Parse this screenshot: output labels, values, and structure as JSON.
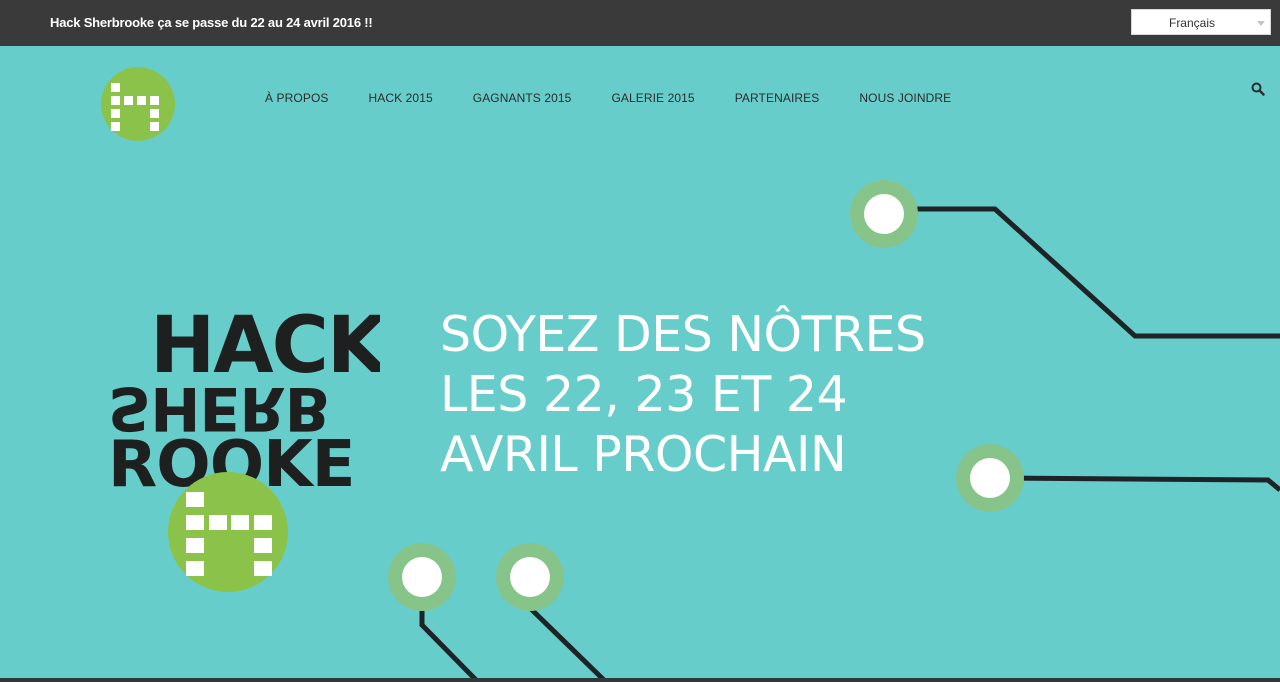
{
  "topbar": {
    "announcement": "Hack Sherbrooke ça se passe du 22 au 24 avril 2016 !!",
    "language": {
      "selected": "Français"
    }
  },
  "nav": {
    "items": [
      {
        "label": "À PROPOS"
      },
      {
        "label": "HACK 2015"
      },
      {
        "label": "GAGNANTS 2015"
      },
      {
        "label": "GALERIE 2015"
      },
      {
        "label": "PARTENAIRES"
      },
      {
        "label": "NOUS JOINDRE"
      }
    ]
  },
  "hero": {
    "logo_text": {
      "line1": "HACK",
      "line2": "SHERB",
      "line3": "ROOKE"
    },
    "lines": [
      "SOYEZ DES NÔTRES",
      "LES 22, 23 ET 24",
      "AVRIL PROCHAIN"
    ]
  },
  "colors": {
    "background": "#67cdcb",
    "topbar": "#3a3a3a",
    "logo_green": "#8bc34a",
    "node_ring": "#86c48a",
    "circuit_line": "#1e2426"
  },
  "icons": {
    "logo": "hack-sherbrooke-logo-icon",
    "search": "search-icon",
    "dropdown": "chevron-down-icon"
  }
}
